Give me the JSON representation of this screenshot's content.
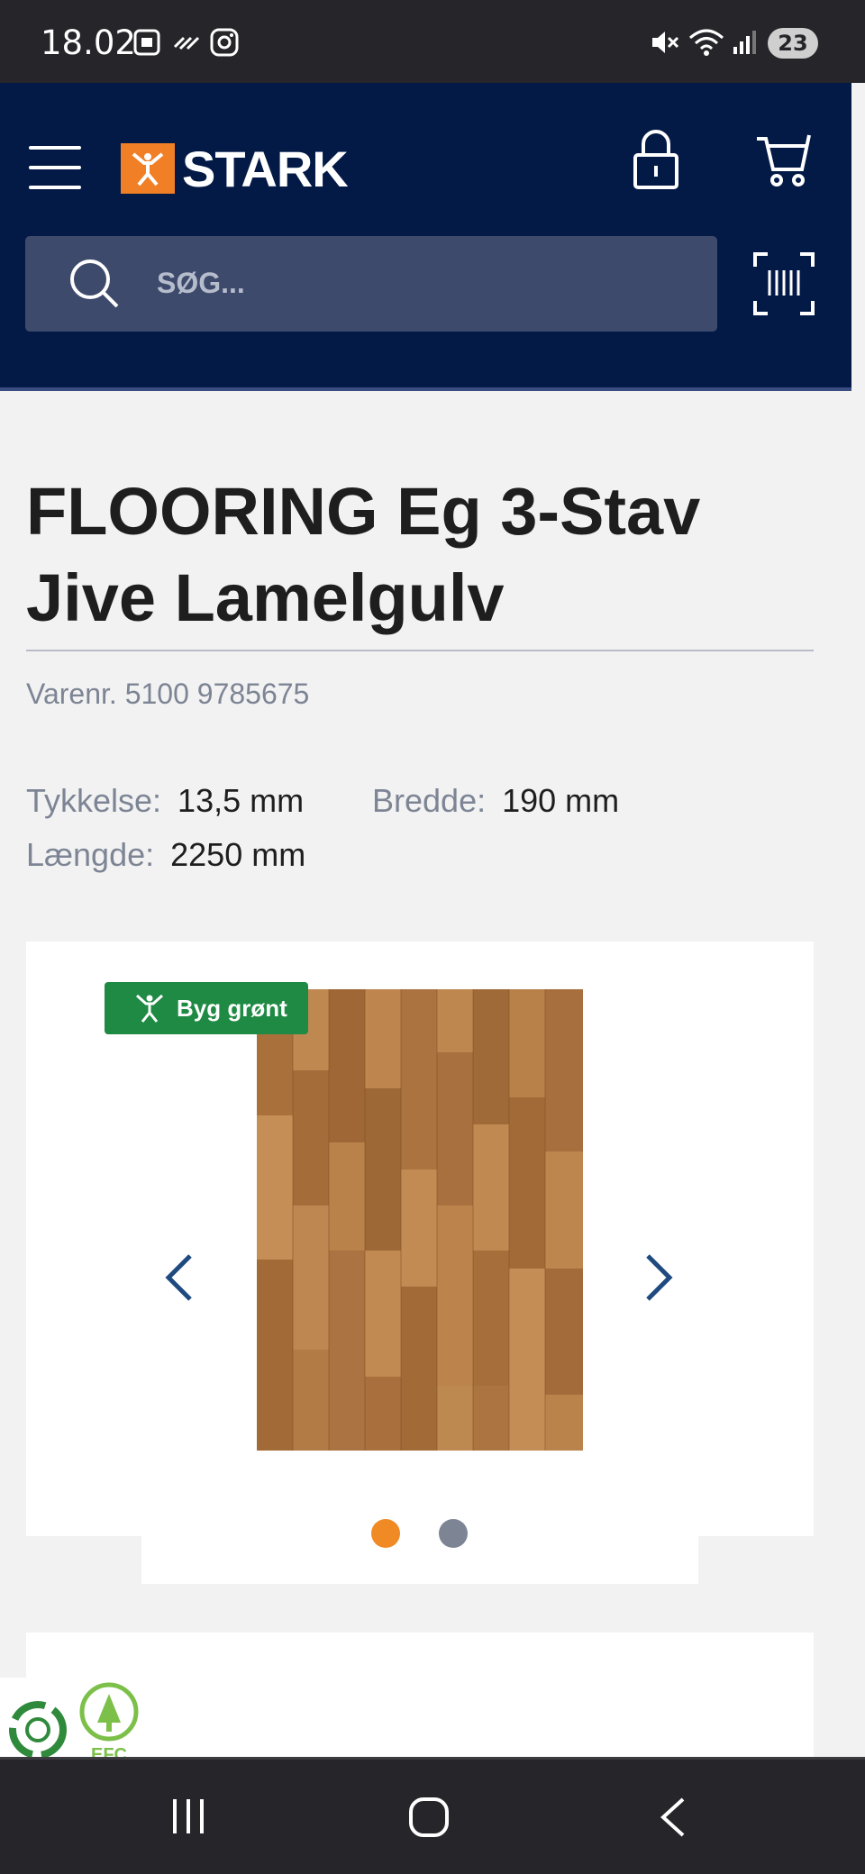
{
  "status_bar": {
    "time": "18.02",
    "battery": "23"
  },
  "header": {
    "logo_text": "STARK",
    "search": {
      "placeholder": "SØG..."
    }
  },
  "product": {
    "title": "FLOORING Eg 3-Stav Jive Lamelgulv",
    "item_number": "Varenr. 5100 9785675",
    "specs": [
      {
        "label": "Tykkelse:",
        "value": "13,5 mm"
      },
      {
        "label": "Bredde:",
        "value": "190 mm"
      },
      {
        "label": "Længde:",
        "value": "2250 mm"
      }
    ],
    "badge": "Byg grønt",
    "gallery": {
      "image_count": 2,
      "active_index": 0
    }
  },
  "colors": {
    "header_bg": "#031a47",
    "brand_orange": "#f07f25",
    "badge_green": "#1e8a43",
    "dot_active": "#f08a24",
    "dot_inactive": "#7d8595"
  }
}
